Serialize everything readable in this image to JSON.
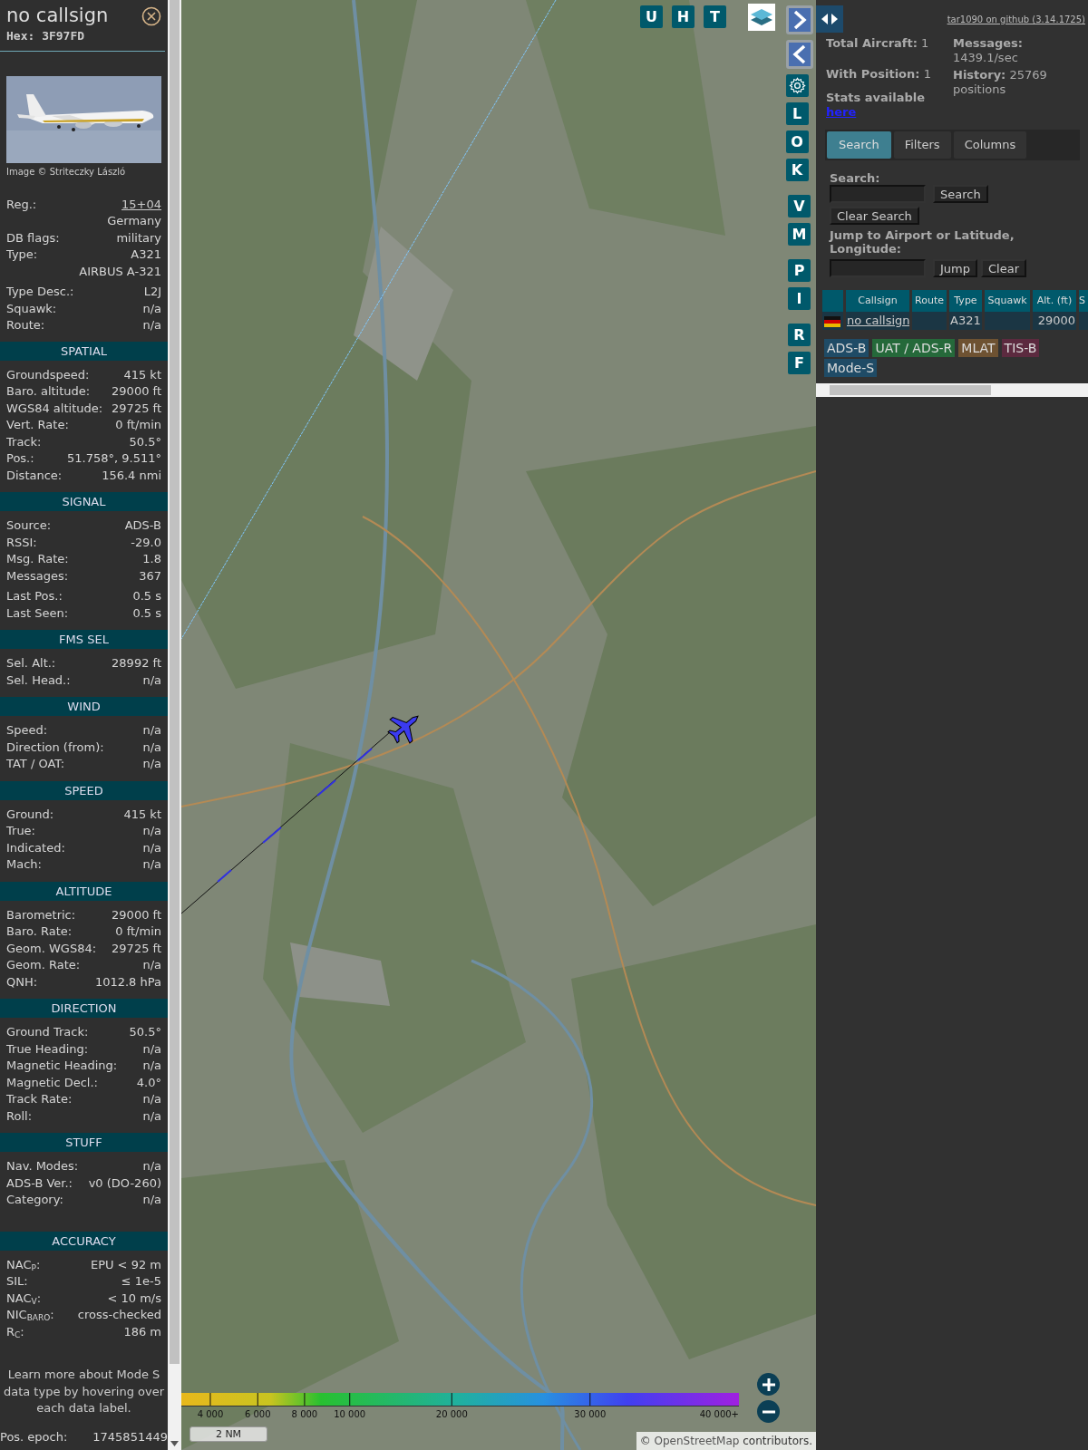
{
  "info_panel": {
    "callsign": "no callsign",
    "hex_label": "Hex:",
    "hex": "3F97FD",
    "photo_credit": "Image © Striteczky László",
    "groups": [
      [
        {
          "label": "Reg.:",
          "link": "15+04"
        },
        {
          "value": "Germany"
        },
        {
          "label": "DB flags:",
          "value": "military"
        },
        {
          "label": "Type:",
          "value": "A321"
        },
        {
          "value": "AIRBUS A-321"
        }
      ],
      [
        {
          "label": "Type Desc.:",
          "value": "L2J"
        },
        {
          "label": "Squawk:",
          "value": "n/a"
        },
        {
          "label": "Route:",
          "value": "n/a"
        }
      ]
    ],
    "sections": [
      {
        "title": "SPATIAL",
        "groups": [
          [
            {
              "label": "Groundspeed:",
              "value": "415 kt"
            },
            {
              "label": "Baro. altitude:",
              "value": "29000 ft"
            },
            {
              "label": "WGS84 altitude:",
              "value": "29725 ft"
            },
            {
              "label": "Vert. Rate:",
              "value": "0 ft/min"
            },
            {
              "label": "Track:",
              "value": "50.5°"
            },
            {
              "label": "Pos.:",
              "value": "51.758°, 9.511°"
            },
            {
              "label": "Distance:",
              "value": "156.4 nmi"
            }
          ]
        ]
      },
      {
        "title": "SIGNAL",
        "groups": [
          [
            {
              "label": "Source:",
              "value": "ADS-B"
            },
            {
              "label": "RSSI:",
              "value": "-29.0"
            },
            {
              "label": "Msg. Rate:",
              "value": "1.8"
            },
            {
              "label": "Messages:",
              "value": "367"
            }
          ],
          [
            {
              "label": "Last Pos.:",
              "value": "0.5 s"
            },
            {
              "label": "Last Seen:",
              "value": "0.5 s"
            }
          ]
        ]
      },
      {
        "title": "FMS SEL",
        "groups": [
          [
            {
              "label": "Sel. Alt.:",
              "value": "28992 ft"
            },
            {
              "label": "Sel. Head.:",
              "value": "n/a"
            }
          ]
        ]
      },
      {
        "title": "WIND",
        "groups": [
          [
            {
              "label": "Speed:",
              "value": "n/a"
            },
            {
              "label": "Direction (from):",
              "value": "n/a"
            },
            {
              "label": "TAT / OAT:",
              "value": "n/a"
            }
          ]
        ]
      },
      {
        "title": "SPEED",
        "groups": [
          [
            {
              "label": "Ground:",
              "value": "415 kt"
            },
            {
              "label": "True:",
              "value": "n/a"
            },
            {
              "label": "Indicated:",
              "value": "n/a"
            },
            {
              "label": "Mach:",
              "value": "n/a"
            }
          ]
        ]
      },
      {
        "title": "ALTITUDE",
        "groups": [
          [
            {
              "label": "Barometric:",
              "value": "29000 ft"
            },
            {
              "label": "Baro. Rate:",
              "value": "0 ft/min"
            },
            {
              "label": "Geom. WGS84:",
              "value": "29725 ft"
            },
            {
              "label": "Geom. Rate:",
              "value": "n/a"
            },
            {
              "label": "QNH:",
              "value": "1012.8 hPa"
            }
          ]
        ]
      },
      {
        "title": "DIRECTION",
        "groups": [
          [
            {
              "label": "Ground Track:",
              "value": "50.5°"
            },
            {
              "label": "True Heading:",
              "value": "n/a"
            },
            {
              "label": "Magnetic Heading:",
              "value": "n/a"
            },
            {
              "label": "Magnetic Decl.:",
              "value": "4.0°"
            },
            {
              "label": "Track Rate:",
              "value": "n/a"
            },
            {
              "label": "Roll:",
              "value": "n/a"
            }
          ]
        ]
      },
      {
        "title": "STUFF",
        "groups": [
          [
            {
              "label": "Nav. Modes:",
              "value": "n/a"
            },
            {
              "label": "ADS-B Ver.:",
              "value": "v0 (DO-260)"
            },
            {
              "label": "Category:",
              "value": "n/a"
            }
          ]
        ]
      },
      {
        "title": "ACCURACY",
        "groups": [
          [
            {
              "label": "NAC$_{P}$:",
              "value": "EPU < 92 m"
            },
            {
              "label": "SIL:",
              "value": "≤ 1e-5"
            },
            {
              "label": "NAC$_{V}$:",
              "value": "< 10 m/s"
            },
            {
              "label": "NIC$_{BARO}$:",
              "value": "cross-checked"
            },
            {
              "label": "R$_{C}$:",
              "value": "186 m"
            }
          ]
        ]
      }
    ],
    "note": "Learn more about Mode S data type by hovering over each data label.",
    "footer": {
      "label": "Pos. epoch:",
      "value": "1745851449"
    }
  },
  "map": {
    "top_buttons": [
      "U",
      "H",
      "T"
    ],
    "side_groups": [
      [
        "L",
        "O",
        "K"
      ],
      [
        "V",
        "M"
      ],
      [
        "P",
        "I"
      ],
      [
        "R",
        "F"
      ]
    ],
    "altitude_legend": [
      "4 000",
      "6 000",
      "8 000",
      "10 000",
      "20 000",
      "30 000",
      "40 000+"
    ],
    "scale": "2 NM",
    "attribution": {
      "prefix": "©",
      "link": "OpenStreetMap",
      "suffix": "contributors."
    }
  },
  "right_panel": {
    "github_link": "tar1090 on github (3.14.1725)",
    "stats_left": [
      {
        "label": "Total Aircraft:",
        "value": "1"
      },
      {
        "label": "With Position:",
        "value": "1"
      }
    ],
    "stats_link_label": "Stats available",
    "stats_link": "here",
    "stats_right": [
      {
        "label": "Messages:",
        "value": "1439.1/sec"
      },
      {
        "label": "History:",
        "value": "25769 positions"
      }
    ],
    "tabs": [
      {
        "label": "Search",
        "selected": true
      },
      {
        "label": "Filters",
        "selected": false
      },
      {
        "label": "Columns",
        "selected": false
      }
    ],
    "search": {
      "label": "Search:",
      "button": "Search",
      "clear": "Clear Search"
    },
    "jump": {
      "label": "Jump to Airport or Latitude, Longitude:",
      "button": "Jump",
      "clear": "Clear"
    },
    "table": {
      "columns": [
        "Callsign",
        "Route",
        "Type",
        "Squawk",
        "Alt. (ft)",
        "S"
      ],
      "rows": [
        {
          "callsign": "no callsign",
          "type": "A321",
          "altitude": "29000"
        }
      ]
    },
    "sources": [
      {
        "label": "ADS-B",
        "color": "#1f4b66"
      },
      {
        "label": "UAT / ADS-R",
        "color": "#25693a"
      },
      {
        "label": "MLAT",
        "color": "#6e5232"
      },
      {
        "label": "TIS-B",
        "color": "#5c2a3f"
      },
      {
        "label": "Mode-S",
        "color": "#1f4b66"
      }
    ]
  }
}
